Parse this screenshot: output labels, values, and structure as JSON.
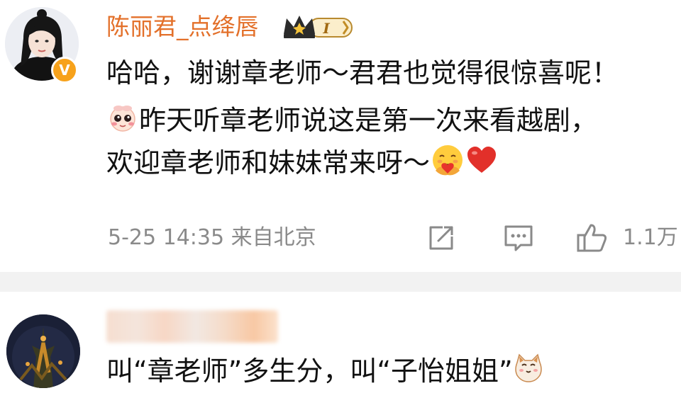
{
  "comment1": {
    "username": "陈丽君_点绛唇",
    "badge": {
      "label": "I"
    },
    "verified_label": "V",
    "lines": [
      "哈哈，谢谢章老师～君君也觉得很惊喜呢！",
      "昨天听章老师说这是第一次来看越剧，",
      "欢迎章老师和妹妹常来呀～"
    ],
    "time": "5-25 14:35",
    "location": "来自北京",
    "like_count": "1.1万"
  },
  "comment2": {
    "text": "叫“章老师”多生分，叫“子怡姐姐”"
  },
  "icons": {
    "share": "share-icon",
    "comment": "comment-icon",
    "like": "thumbs-up-icon",
    "crown": "crown-icon",
    "emoji_shy": "shy-emoji-icon",
    "emoji_hug": "hug-emoji-icon",
    "emoji_heart": "heart-icon",
    "emoji_cat": "cat-emoji-icon"
  },
  "colors": {
    "username": "#e3702a",
    "meta": "#8a8a8a",
    "text": "#111111",
    "divider": "#f2f2f2",
    "verified": "#f7a21b"
  }
}
